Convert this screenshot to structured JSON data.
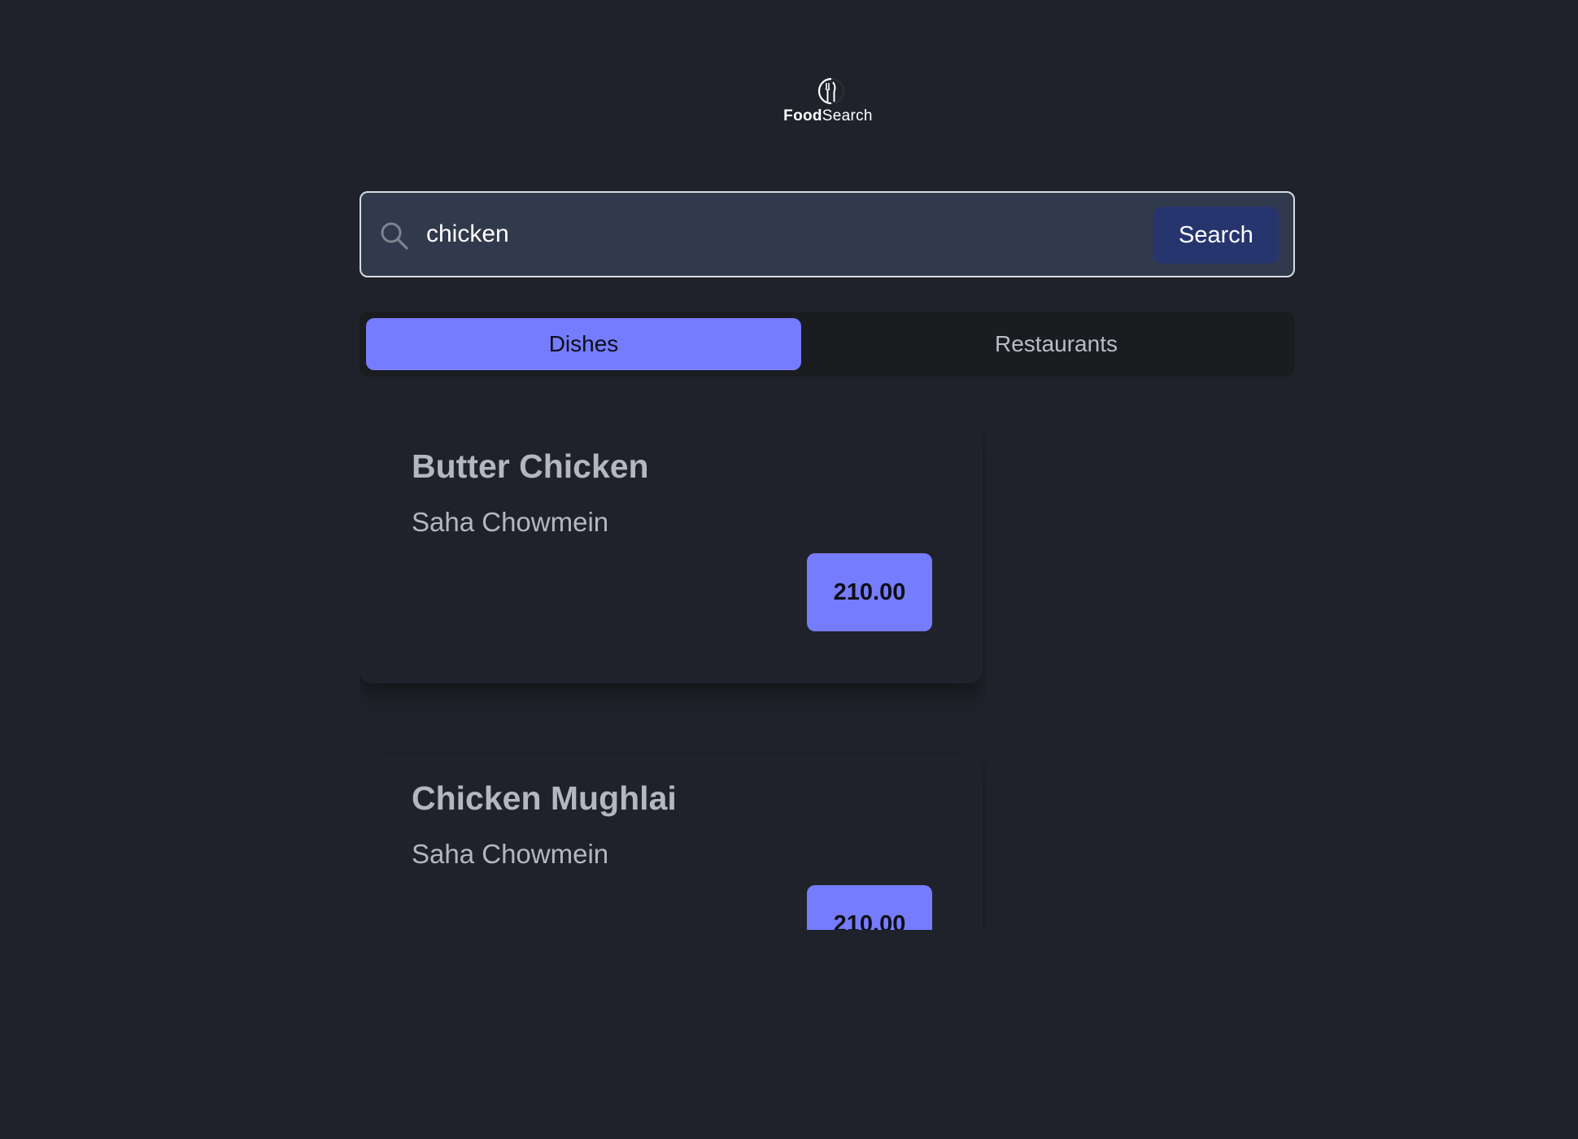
{
  "brand": {
    "name_bold": "Food",
    "name_regular": "Search",
    "icon": "fork-knife-logo-icon"
  },
  "search": {
    "value": "chicken",
    "icon": "search-icon",
    "button_label": "Search"
  },
  "tabs": [
    {
      "label": "Dishes",
      "active": true
    },
    {
      "label": "Restaurants",
      "active": false
    }
  ],
  "results": [
    {
      "dish": "Butter Chicken",
      "restaurant": "Saha Chowmein",
      "price": "210.00"
    },
    {
      "dish": "Chicken Mughlai",
      "restaurant": "Saha Chowmein",
      "price": "210.00"
    }
  ],
  "colors": {
    "background": "#1f222a",
    "accent": "#767cfe",
    "search_button": "#27356f",
    "search_field": "#313a4c",
    "tab_track": "#1a1c20"
  }
}
